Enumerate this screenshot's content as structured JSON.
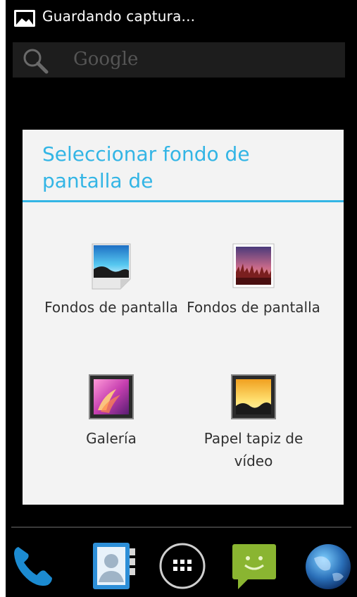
{
  "status_bar": {
    "notification_text": "Guardando captura...",
    "icon": "screenshot-icon"
  },
  "search_bar": {
    "placeholder": "Google",
    "icon": "search-icon"
  },
  "dialog": {
    "title": "Seleccionar fondo de pantalla de",
    "accent_color": "#33b5e5",
    "options": [
      {
        "label": "Fondos de pantalla",
        "icon": "wallpapers-icon"
      },
      {
        "label": "Fondos de pantalla",
        "icon": "wallpapers-sunset-icon"
      },
      {
        "label": "Galería",
        "icon": "gallery-icon"
      },
      {
        "label": "Papel tapiz de vídeo",
        "icon": "video-wallpaper-icon"
      }
    ]
  },
  "dock": {
    "items": [
      {
        "icon": "phone-icon"
      },
      {
        "icon": "contacts-icon"
      },
      {
        "icon": "app-drawer-icon"
      },
      {
        "icon": "messaging-icon"
      },
      {
        "icon": "browser-icon"
      }
    ]
  }
}
